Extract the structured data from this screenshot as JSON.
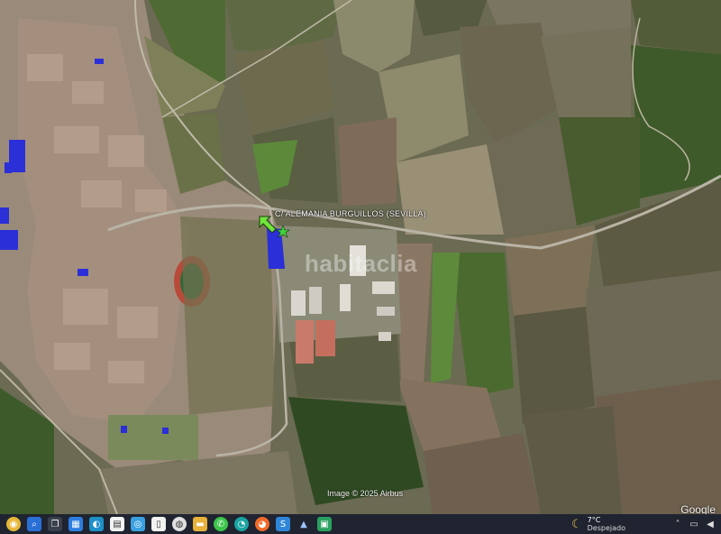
{
  "map": {
    "placemark_label": "C/ ALEMANIA  BURGUILLOS (SEVILLA)",
    "watermark": "habitaclia",
    "imagery_credit": "Image © 2025 Airbus",
    "logo_text": "Google",
    "parcel_color": "#2b2fd8",
    "arrow_color": "#6fe63a",
    "marker_color": "#3fd13a",
    "road_color": "#b9b4a6"
  },
  "taskbar": {
    "icons": [
      "start-icon",
      "search-icon",
      "task-view-icon",
      "file-explorer-icon",
      "photos-icon",
      "edge-icon",
      "store-icon",
      "document-icon",
      "chrome-icon",
      "folder-icon",
      "whatsapp-icon",
      "browser-icon",
      "firefox-icon",
      "app-s-icon",
      "app-a-icon",
      "app-x-icon"
    ],
    "weather": {
      "temperature": "7°C",
      "condition": "Despejado"
    }
  }
}
